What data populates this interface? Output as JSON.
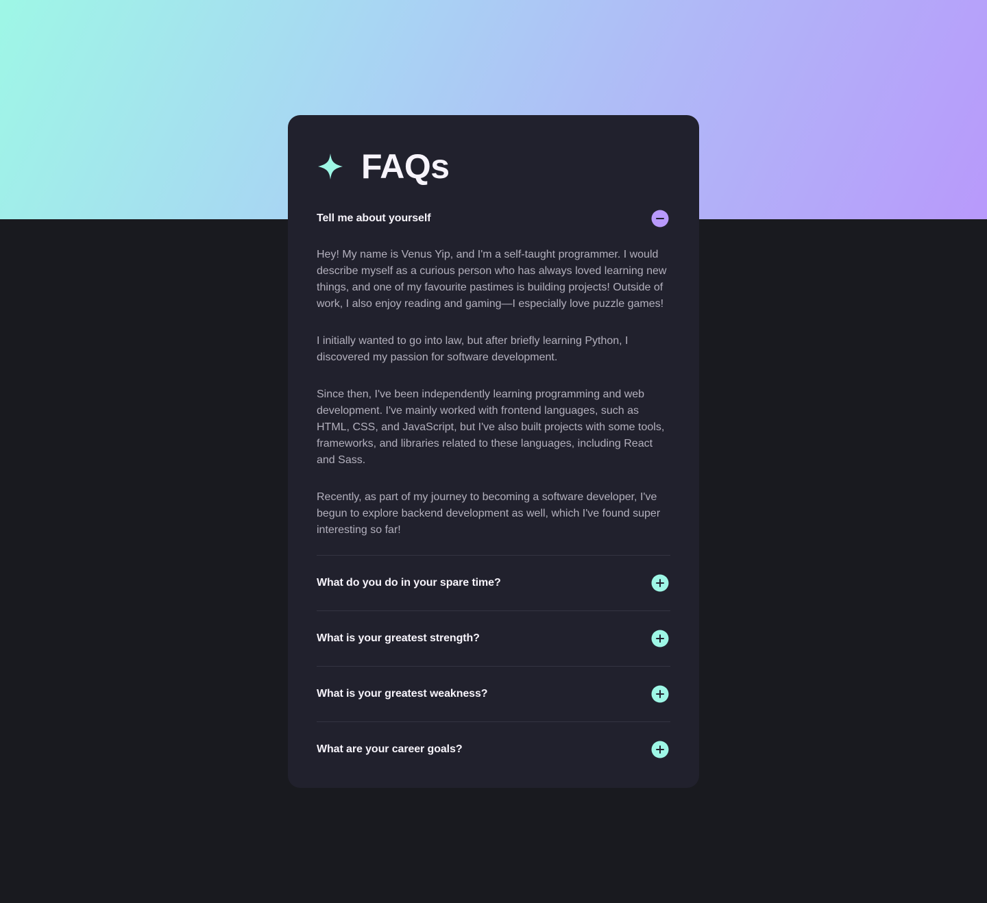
{
  "colors": {
    "page_bg": "#191a1f",
    "hero_gradient": [
      "#9ef7e6",
      "#a8d6f3",
      "#b0b8f7",
      "#b899fb"
    ],
    "card_bg": "#21212d",
    "accent_mint": "#9ef7e6",
    "accent_purple": "#b899fb",
    "heading_text": "#f7f4fb",
    "body_text": "#b3b0bd"
  },
  "card": {
    "title": "FAQs",
    "title_icon": "sparkle-star-icon"
  },
  "faqs": [
    {
      "question": "Tell me about yourself",
      "expanded": true,
      "icon": "minus-circle-icon",
      "answer": [
        "Hey! My name is Venus Yip, and I'm a self-taught programmer. I would describe myself as a curious person who has always loved learning new things, and one of my favourite pastimes is building projects! Outside of work, I also enjoy reading and gaming—I especially love puzzle games!",
        "I initially wanted to go into law, but after briefly learning Python, I discovered my passion for software development.",
        "Since then, I've been independently learning programming and web development. I've mainly worked with frontend languages, such as HTML, CSS, and JavaScript, but I've also built projects with some tools, frameworks, and libraries related to these languages, including React and Sass.",
        "Recently, as part of my journey to becoming a software developer, I've begun to explore backend development as well, which I've found super interesting so far!"
      ]
    },
    {
      "question": "What do you do in your spare time?",
      "expanded": false,
      "icon": "plus-circle-icon"
    },
    {
      "question": "What is your greatest strength?",
      "expanded": false,
      "icon": "plus-circle-icon"
    },
    {
      "question": "What is your greatest weakness?",
      "expanded": false,
      "icon": "plus-circle-icon"
    },
    {
      "question": "What are your career goals?",
      "expanded": false,
      "icon": "plus-circle-icon"
    }
  ]
}
